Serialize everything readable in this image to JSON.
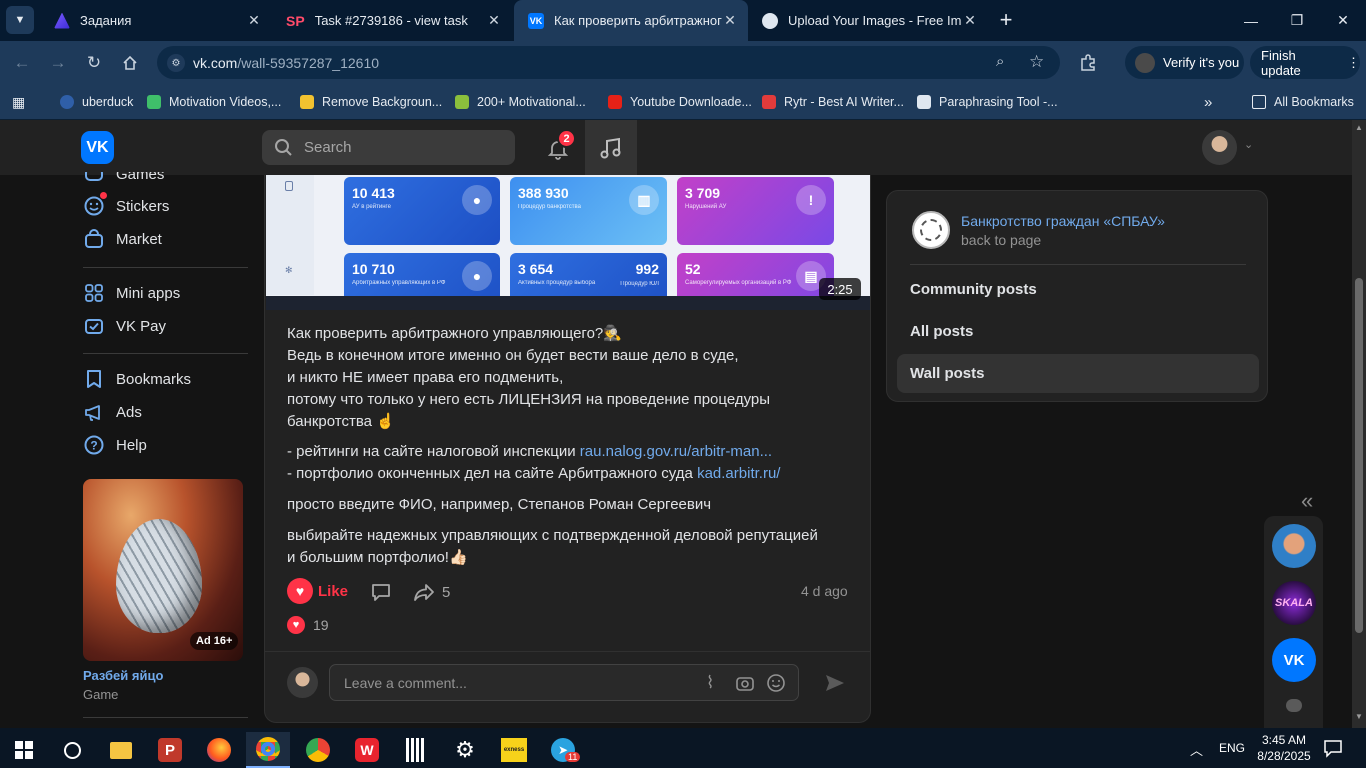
{
  "browser": {
    "tabs": [
      {
        "title": "Задания"
      },
      {
        "title": "Task #2739186 - view task"
      },
      {
        "title": "Как проверить арбитражного"
      },
      {
        "title": "Upload Your Images - Free Imag"
      }
    ],
    "url_host": "vk.com",
    "url_path": "/wall-59357287_12610",
    "verify_label": "Verify it's you",
    "update_label": "Finish update",
    "bookmarks": [
      "uberduck",
      "Motivation Videos,...",
      "Remove Backgroun...",
      "200+ Motivational...",
      "Youtube Downloade...",
      "Rytr - Best AI Writer...",
      "Paraphrasing Tool -..."
    ],
    "all_bookmarks": "All Bookmarks",
    "colors": {
      "frame": "#061a30",
      "toolbar": "#1e3a5a"
    }
  },
  "vk": {
    "logo": "VK",
    "search_placeholder": "Search",
    "notif_count": "2",
    "left_menu": {
      "games": "Games",
      "stickers": "Stickers",
      "market": "Market",
      "mini_apps": "Mini apps",
      "vk_pay": "VK Pay",
      "bookmarks": "Bookmarks",
      "ads": "Ads",
      "help": "Help"
    },
    "ad": {
      "badge": "Ad 16+",
      "title": "Разбей яйцо",
      "subtitle": "Game"
    },
    "post": {
      "video": {
        "duration": "2:25",
        "stats": [
          {
            "value": "10 413",
            "label": "АУ в рейтинге"
          },
          {
            "value": "388 930",
            "label": "Процедур банкротства"
          },
          {
            "value": "3 709",
            "label": "Нарушений АУ"
          },
          {
            "value": "10 710",
            "label": "Арбитражных управляющих в РФ"
          },
          {
            "value": "3 654",
            "label": "Активных процедур выбора"
          },
          {
            "value": "992",
            "label": "Процедур ЮЛ"
          },
          {
            "value": "52",
            "label": "Саморегулируемых организаций в РФ"
          }
        ]
      },
      "lines": [
        "Как проверить арбитражного управляющего?🕵️",
        "Ведь в конечном итоге именно он будет вести ваше дело в суде,",
        "и никто НЕ имеет права его подменить,",
        "потому что только у него есть ЛИЦЕНЗИЯ на проведение процедуры",
        "банкротства ☝️"
      ],
      "link1_prefix": "- рейтинги на сайте налоговой инспекции ",
      "link1": "rau.nalog.gov.ru/arbitr-man...",
      "link2_prefix": "- портфолио оконченных дел на сайте Арбитражного суда ",
      "link2": "kad.arbitr.ru/",
      "para3": "просто введите ФИО, например, Степанов Роман Сергеевич",
      "para4_l1": "выбирайте надежных управляющих с подтвержденной деловой репутацией",
      "para4_l2": "и большим портфолио!👍🏻",
      "like_label": "Like",
      "share_count": "5",
      "time_ago": "4 d ago",
      "likes_count": "19",
      "comment_placeholder": "Leave a comment..."
    },
    "community": {
      "name": "Банкротство граждан «СПБАУ»",
      "back": "back to page",
      "nav": [
        "Community posts",
        "All posts",
        "Wall posts"
      ],
      "active_index": 2
    },
    "colors": {
      "accent": "#0077ff",
      "like": "#ff3347",
      "link": "#71aaeb"
    }
  },
  "taskbar": {
    "lang": "ENG",
    "time": "3:45 AM",
    "date": "8/28/2025",
    "telegram_badge": "11",
    "exness_label": "exness"
  }
}
